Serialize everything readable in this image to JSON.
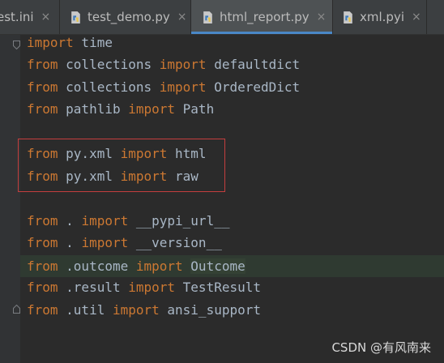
{
  "tabs": [
    {
      "label": "est.ini",
      "type": "ini",
      "active": false
    },
    {
      "label": "test_demo.py",
      "type": "python",
      "active": false
    },
    {
      "label": "html_report.py",
      "type": "python",
      "active": true
    },
    {
      "label": "xml.pyi",
      "type": "python",
      "active": false
    }
  ],
  "tab_close_symbol": "×",
  "code_lines": [
    {
      "kw1": "import",
      "text1": " time"
    },
    {
      "kw1": "from",
      "text1": " collections ",
      "kw2": "import",
      "text2": " defaultdict"
    },
    {
      "kw1": "from",
      "text1": " collections ",
      "kw2": "import",
      "text2": " OrderedDict"
    },
    {
      "kw1": "from",
      "text1": " pathlib ",
      "kw2": "import",
      "text2": " Path"
    },
    {},
    {
      "kw1": "from",
      "text1": " py.xml ",
      "kw2": "import",
      "text2": " html"
    },
    {
      "kw1": "from",
      "text1": " py.xml ",
      "kw2": "import",
      "text2": " raw"
    },
    {},
    {
      "kw1": "from",
      "text1": " . ",
      "kw2": "import",
      "text2": " __pypi_url__"
    },
    {
      "kw1": "from",
      "text1": " . ",
      "kw2": "import",
      "text2": " __version__"
    },
    {
      "kw1": "from",
      "text1": " .outcome ",
      "kw2": "import",
      "text2": " ",
      "hl": "Outcome"
    },
    {
      "kw1": "from",
      "text1": " .result ",
      "kw2": "import",
      "text2": " TestResult"
    },
    {
      "kw1": "from",
      "text1": " .util ",
      "kw2": "import",
      "text2": " ansi_support"
    }
  ],
  "watermark": "CSDN @有风南来",
  "colors": {
    "background": "#2b2b2b",
    "keyword": "#cc7832",
    "identifier": "#a9b7c6",
    "annotation_box": "#c43e3e",
    "active_tab_underline": "#4a88c7"
  }
}
